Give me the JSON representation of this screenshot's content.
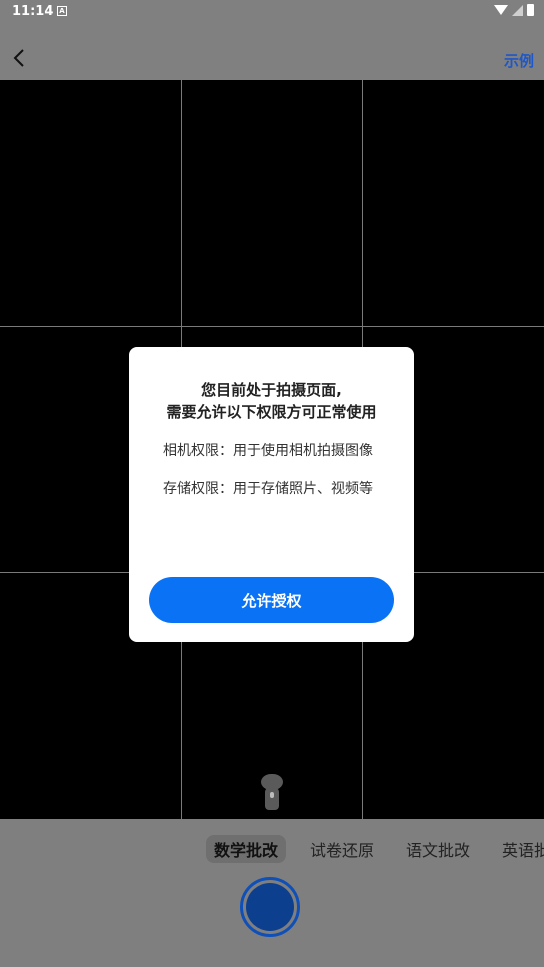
{
  "status_bar": {
    "time": "11:14",
    "notification_icon_label": "A"
  },
  "top_bar": {
    "example_label": "示例"
  },
  "dialog": {
    "title_line1": "您目前处于拍摄页面,",
    "title_line2": "需要允许以下权限方可正常使用",
    "camera_permission": "相机权限：用于使用相机拍摄图像",
    "storage_permission": "存储权限：用于存储照片、视频等",
    "allow_button": "允许授权"
  },
  "modes": [
    "数学批改",
    "试卷还原",
    "语文批改",
    "英语批"
  ],
  "colors": {
    "accent": "#0a73f5",
    "link": "#1e57c8",
    "shutter": "#0d3f8f"
  }
}
